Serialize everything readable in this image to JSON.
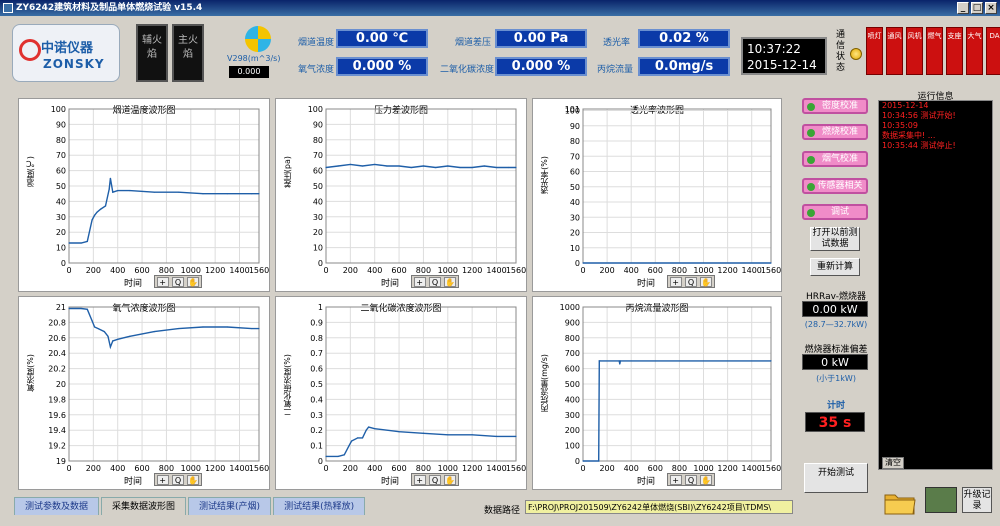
{
  "window": {
    "title": "ZY6242建筑材料及制品单体燃烧试验 v15.4"
  },
  "logo": {
    "cn": "中诺仪器",
    "en": "ZONSKY"
  },
  "flame": {
    "aux": "辅火焰",
    "main": "主火焰"
  },
  "fan": {
    "label": "V298(m^3/s)",
    "value": "0.000"
  },
  "params": [
    {
      "label": "烟道温度",
      "value": "0.00 ℃"
    },
    {
      "label": "氧气浓度",
      "value": "0.000 %"
    },
    {
      "label": "烟道差压",
      "value": "0.00 Pa"
    },
    {
      "label": "二氧化碳浓度",
      "value": "0.000 %"
    },
    {
      "label": "透光率",
      "value": "0.02 %"
    },
    {
      "label": "丙烷流量",
      "value": "0.0mg/s"
    }
  ],
  "clock": {
    "time": "10:37:22",
    "date": "2015-12-14"
  },
  "comm": {
    "label": "通信状态"
  },
  "relays": [
    "喷灯",
    "通风",
    "风机",
    "燃气",
    "支座",
    "大气",
    "DA"
  ],
  "buttons": {
    "density_cal": "密度校准",
    "balance_cal": "燃烧校准",
    "smoke_cal": "烟气校准",
    "sensor_rel": "传感器相关",
    "debug": "调试",
    "open_prev": "打开以前测试数据",
    "recalc": "重新计算",
    "start": "开始测试",
    "upgrade": "升级记录",
    "clear": "清空"
  },
  "side": {
    "hrr_label": "HRRav-燃烧器",
    "hrr_value": "0.00 kW",
    "hrr_range": "(28.7—32.7kW)",
    "dev_label": "燃烧器标准偏差",
    "dev_value": "0 kW",
    "dev_note": "(小于1kW)",
    "timer_label": "计时",
    "timer_value": "35 s"
  },
  "log": {
    "title": "运行信息",
    "lines": [
      "2015-12-14",
      "10:34:56 测试开始!",
      "10:35:09",
      "数据采集中! ...",
      "10:35:44 测试停止!"
    ]
  },
  "tabs": [
    "测试参数及数据",
    "采集数据波形图",
    "测试结果(产烟)",
    "测试结果(热释放)"
  ],
  "path": {
    "label": "数据路径",
    "value": "F:\\PROJ\\PROJ201509\\ZY6242单体燃烧(SBI)\\ZY6242项目\\TDMS\\"
  },
  "colors": {
    "trace": "#1f5fa8",
    "relay": "#cc1010",
    "param_bg": "#0b3aa8"
  },
  "chart_data": [
    {
      "type": "line",
      "title": "烟道温度波形图",
      "xlabel": "时间",
      "ylabel": "温度(℃)",
      "xlim": [
        0,
        1560
      ],
      "ylim": [
        0,
        100
      ],
      "xticks": [
        0,
        200,
        400,
        600,
        800,
        1000,
        1200,
        1400,
        1560
      ],
      "yticks": [
        0,
        10,
        20,
        30,
        40,
        50,
        60,
        70,
        80,
        90,
        100
      ],
      "x": [
        0,
        100,
        150,
        190,
        210,
        230,
        260,
        300,
        330,
        340,
        360,
        400,
        500,
        700,
        900,
        1100,
        1300,
        1500,
        1560
      ],
      "y": [
        13,
        13,
        14,
        28,
        31,
        33,
        35,
        37,
        48,
        55,
        46,
        47,
        47,
        46,
        46,
        45,
        45,
        45,
        45
      ]
    },
    {
      "type": "line",
      "title": "压力差波形图",
      "xlabel": "时间",
      "ylabel": "差压(pa)",
      "xlim": [
        0,
        1560
      ],
      "ylim": [
        0,
        100
      ],
      "xticks": [
        0,
        200,
        400,
        600,
        800,
        1000,
        1200,
        1400,
        1560
      ],
      "yticks": [
        0,
        10,
        20,
        30,
        40,
        50,
        60,
        70,
        80,
        90,
        100
      ],
      "x": [
        0,
        100,
        200,
        300,
        400,
        500,
        600,
        700,
        800,
        900,
        1000,
        1100,
        1200,
        1300,
        1400,
        1500,
        1560
      ],
      "y": [
        62,
        63,
        64,
        63,
        64,
        63,
        63,
        62,
        63,
        62,
        63,
        62,
        62,
        63,
        62,
        62,
        62
      ]
    },
    {
      "type": "line",
      "title": "透光率波形图",
      "xlabel": "时间",
      "ylabel": "透光率(%)",
      "xlim": [
        0,
        1560
      ],
      "ylim": [
        0,
        101
      ],
      "xticks": [
        0,
        200,
        400,
        600,
        800,
        1000,
        1200,
        1400,
        1560
      ],
      "yticks": [
        0,
        10,
        20,
        30,
        40,
        50,
        60,
        70,
        80,
        90,
        100,
        101
      ],
      "x": [
        0,
        1560
      ],
      "y": [
        0,
        0
      ]
    },
    {
      "type": "line",
      "title": "氧气浓度波形图",
      "xlabel": "时间",
      "ylabel": "氧浓度(%)",
      "xlim": [
        0,
        1560
      ],
      "ylim": [
        19,
        21
      ],
      "xticks": [
        0,
        200,
        400,
        600,
        800,
        1000,
        1200,
        1400,
        1560
      ],
      "yticks": [
        19,
        19.2,
        19.4,
        19.6,
        19.8,
        20,
        20.2,
        20.4,
        20.6,
        20.8,
        21
      ],
      "x": [
        0,
        100,
        150,
        190,
        210,
        240,
        290,
        320,
        340,
        360,
        400,
        500,
        700,
        900,
        1100,
        1300,
        1500,
        1560
      ],
      "y": [
        20.98,
        20.98,
        20.97,
        20.82,
        20.74,
        20.72,
        20.68,
        20.62,
        20.48,
        20.56,
        20.58,
        20.62,
        20.68,
        20.72,
        20.74,
        20.74,
        20.72,
        20.72
      ]
    },
    {
      "type": "line",
      "title": "二氧化碳浓度波形图",
      "xlabel": "时间",
      "ylabel": "二氧化碳浓度(%)",
      "xlim": [
        0,
        1560
      ],
      "ylim": [
        0,
        1
      ],
      "xticks": [
        0,
        200,
        400,
        600,
        800,
        1000,
        1200,
        1400,
        1560
      ],
      "yticks": [
        0,
        0.1,
        0.2,
        0.3,
        0.4,
        0.5,
        0.6,
        0.7,
        0.8,
        0.9,
        1
      ],
      "x": [
        0,
        100,
        150,
        190,
        210,
        260,
        300,
        330,
        350,
        400,
        600,
        800,
        1000,
        1200,
        1400,
        1560
      ],
      "y": [
        0.03,
        0.03,
        0.04,
        0.1,
        0.13,
        0.15,
        0.15,
        0.2,
        0.22,
        0.21,
        0.19,
        0.18,
        0.17,
        0.17,
        0.16,
        0.16
      ]
    },
    {
      "type": "line",
      "title": "丙烷流量波形图",
      "xlabel": "时间",
      "ylabel": "丙烷流量(mg/s)",
      "xlim": [
        0,
        1560
      ],
      "ylim": [
        0,
        1000
      ],
      "xticks": [
        0,
        200,
        400,
        600,
        800,
        1000,
        1200,
        1400,
        1560
      ],
      "yticks": [
        0,
        100,
        200,
        300,
        400,
        500,
        600,
        700,
        800,
        900,
        1000
      ],
      "x": [
        0,
        130,
        135,
        140,
        300,
        305,
        310,
        1560
      ],
      "y": [
        0,
        0,
        650,
        650,
        650,
        630,
        650,
        650
      ]
    }
  ]
}
